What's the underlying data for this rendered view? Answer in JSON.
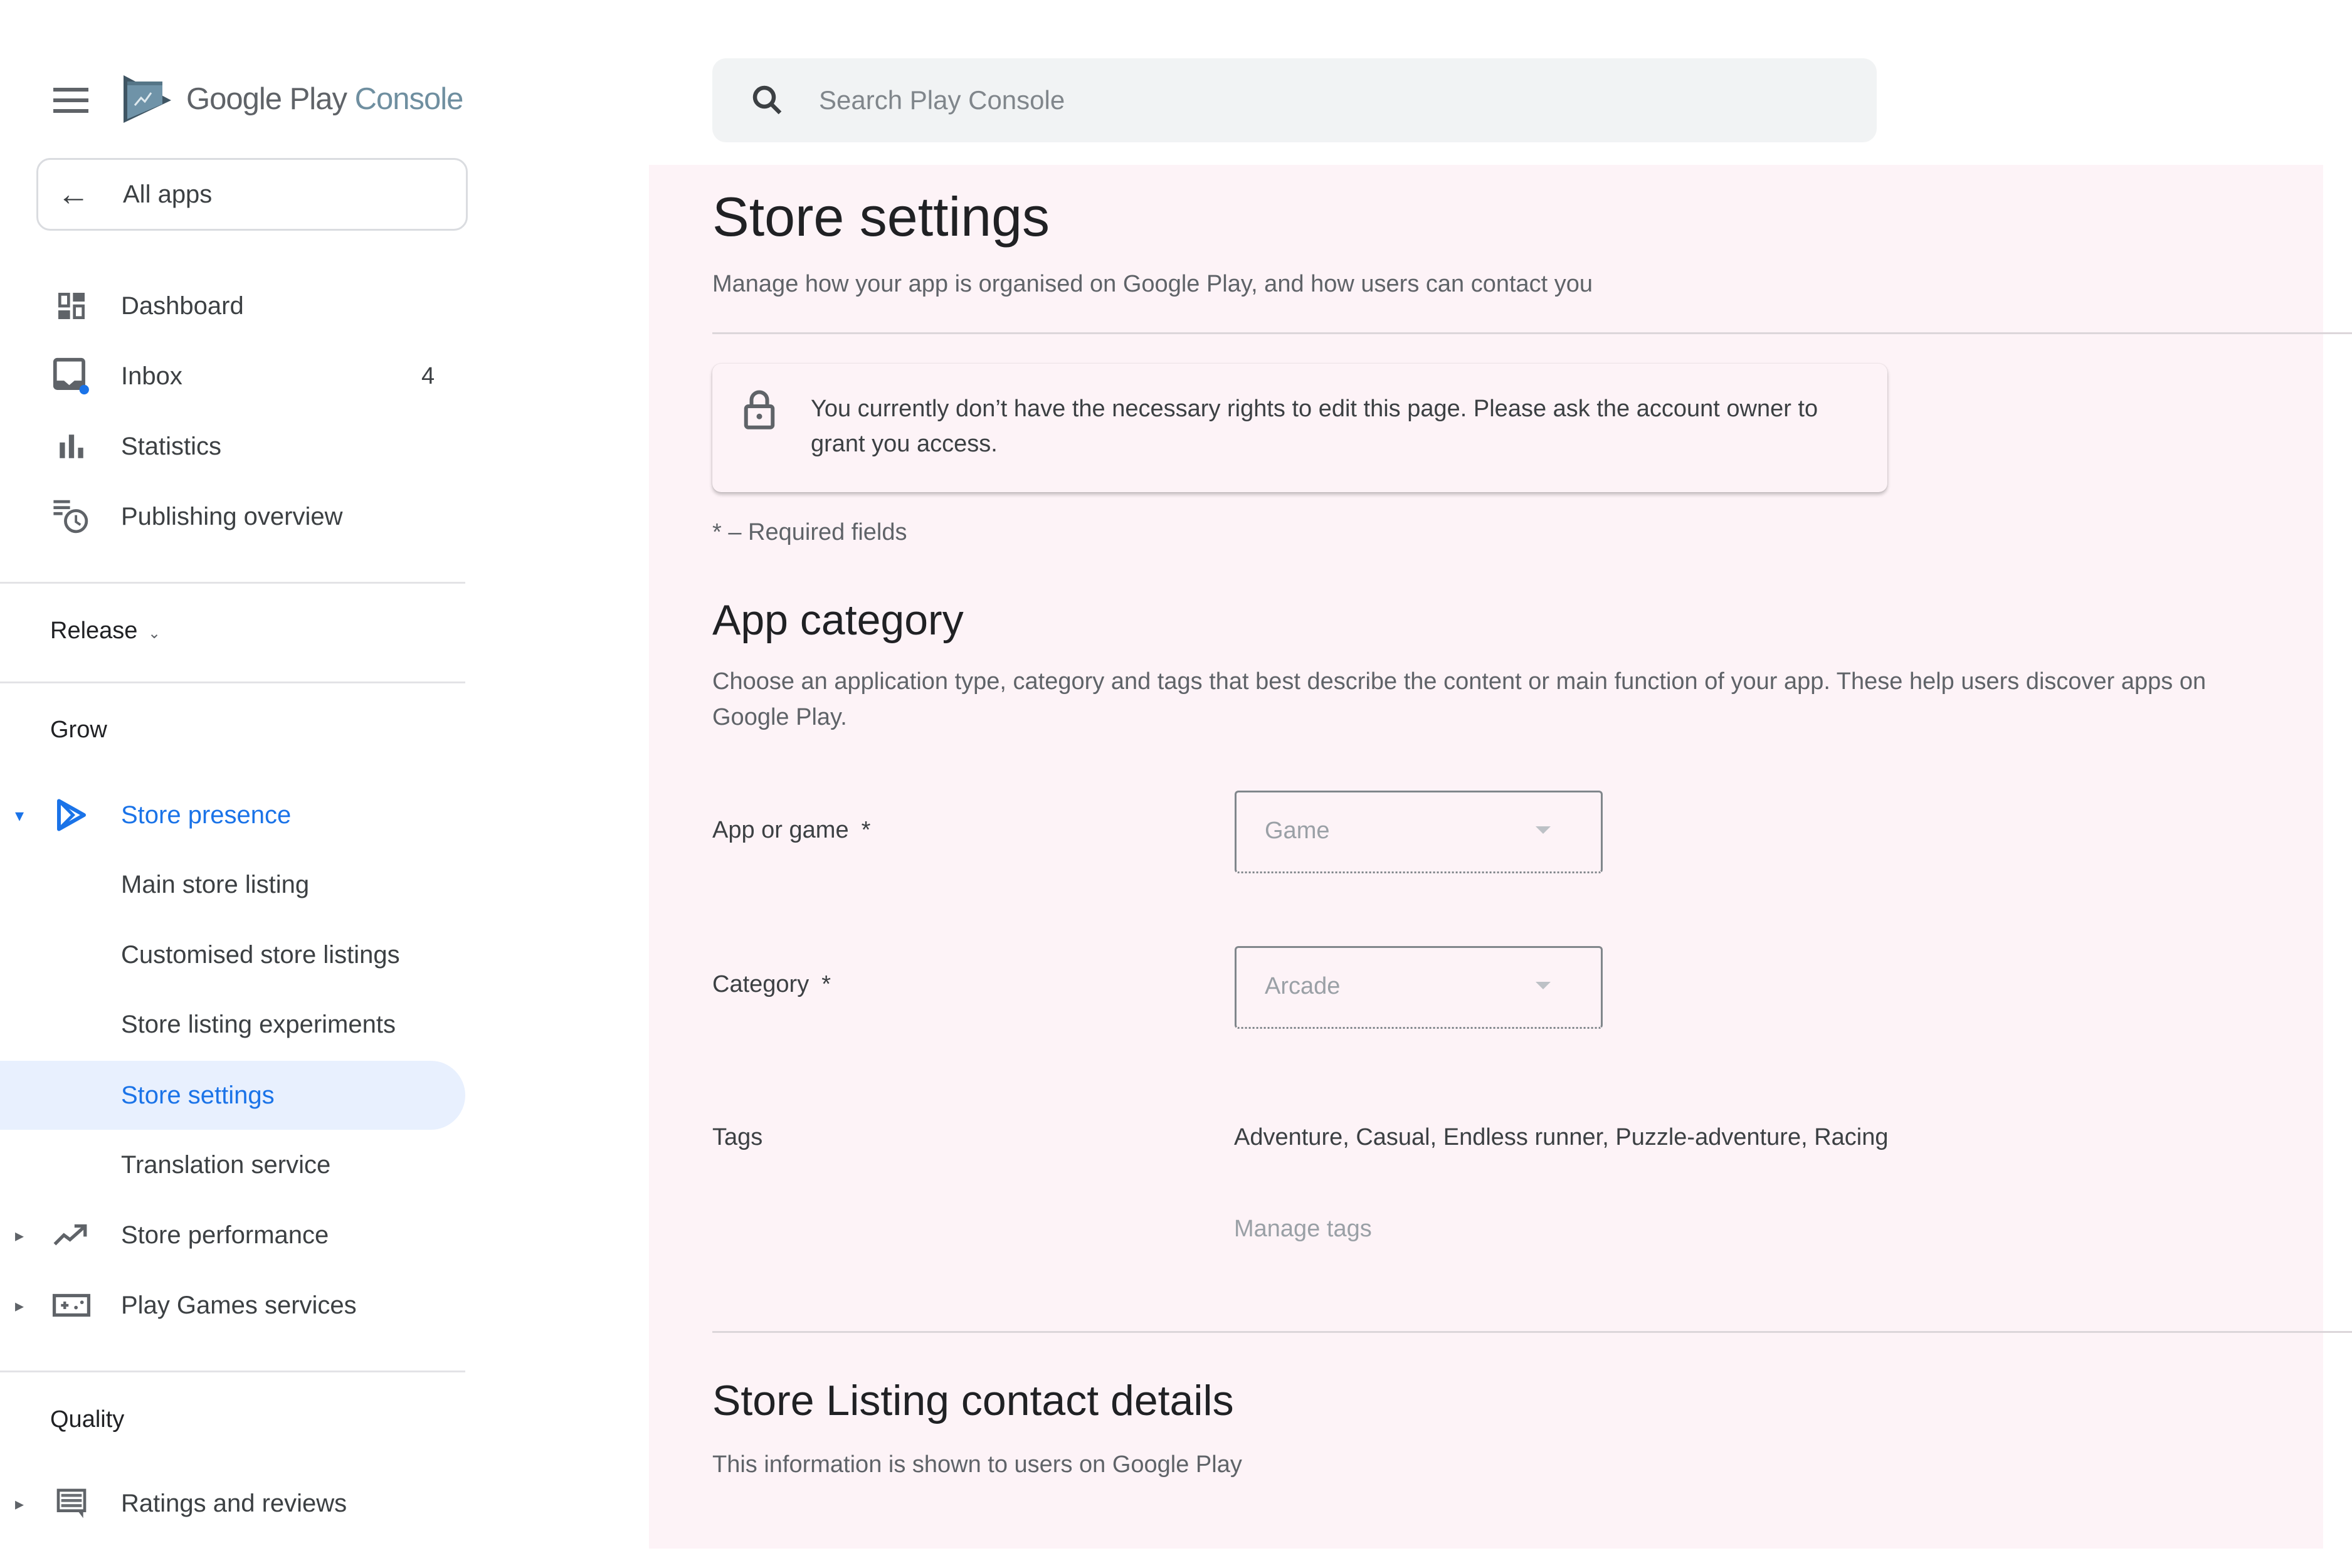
{
  "app": {
    "logo_main": "Google Play",
    "logo_suffix": "Console",
    "brand_color": "#1a73e8"
  },
  "sidebar": {
    "all_apps_label": "All apps",
    "top_items": [
      {
        "label": "Dashboard",
        "icon": "dashboard-icon"
      },
      {
        "label": "Inbox",
        "icon": "inbox-icon",
        "badge": "4"
      },
      {
        "label": "Statistics",
        "icon": "bar-chart-icon"
      },
      {
        "label": "Publishing overview",
        "icon": "publishing-clock-icon"
      }
    ],
    "release_label": "Release",
    "grow_label": "Grow",
    "store_presence": {
      "label": "Store presence",
      "icon": "play-outline-icon",
      "expanded": true,
      "children": [
        {
          "label": "Main store listing"
        },
        {
          "label": "Customised store listings"
        },
        {
          "label": "Store listing experiments"
        },
        {
          "label": "Store settings",
          "selected": true
        },
        {
          "label": "Translation service"
        }
      ]
    },
    "store_performance_label": "Store performance",
    "play_games_label": "Play Games services",
    "quality_label": "Quality",
    "ratings_label": "Ratings and reviews"
  },
  "search": {
    "placeholder": "Search Play Console"
  },
  "page": {
    "title": "Store settings",
    "subtitle": "Manage how your app is organised on Google Play, and how users can contact you",
    "notice": "You currently don’t have the necessary rights to edit this page. Please ask the account owner to grant you access.",
    "required_note": "* – Required fields"
  },
  "app_category": {
    "title": "App category",
    "description": "Choose an application type, category and tags that best describe the content or main function of your app. These help users discover apps on Google Play.",
    "app_or_game_label": "App or game",
    "app_or_game_value": "Game",
    "category_label": "Category",
    "category_value": "Arcade",
    "required_mark": "*",
    "tags_label": "Tags",
    "tags_value": "Adventure, Casual, Endless runner, Puzzle-adventure, Racing",
    "manage_tags_label": "Manage tags"
  },
  "contact": {
    "title": "Store Listing contact details",
    "description": "This information is shown to users on Google Play"
  }
}
